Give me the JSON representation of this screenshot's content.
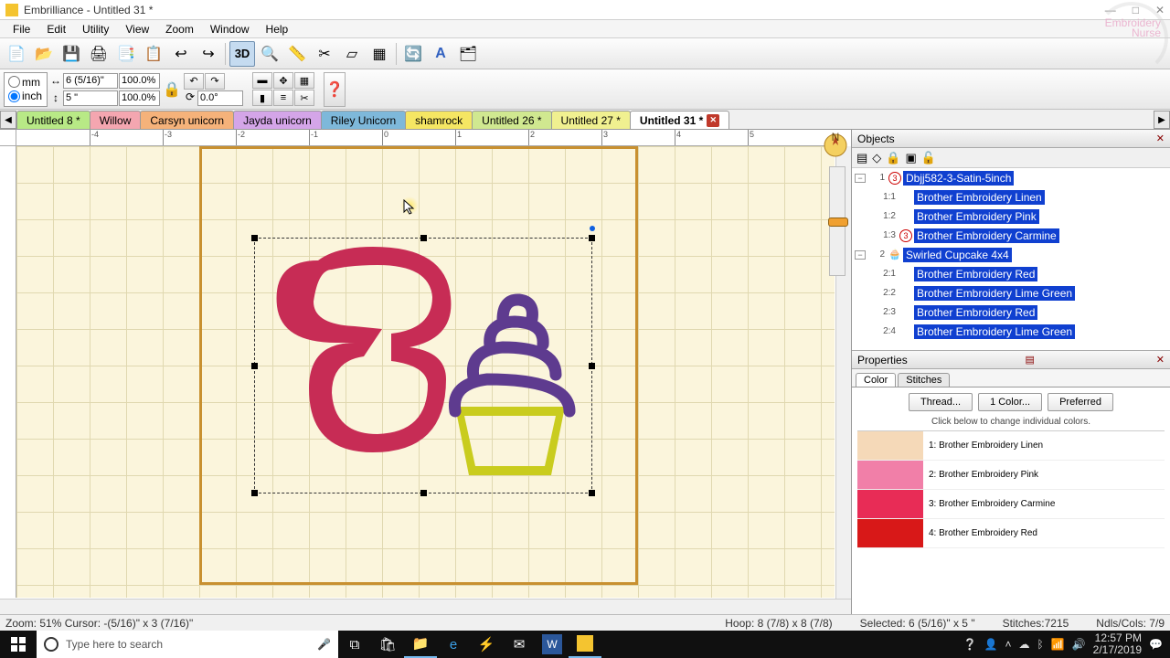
{
  "titlebar": {
    "text": "Embrilliance  -  Untitled 31 *"
  },
  "menu": [
    "File",
    "Edit",
    "Utility",
    "View",
    "Zoom",
    "Window",
    "Help"
  ],
  "units": {
    "mm": "mm",
    "inch": "inch"
  },
  "dims": {
    "w": "6 (5/16)\"",
    "h": "5 \"",
    "wp": "100.0%",
    "hp": "100.0%",
    "rot": "0.0°"
  },
  "tabs": [
    {
      "label": "Untitled 8 *"
    },
    {
      "label": "Willow"
    },
    {
      "label": "Carsyn unicorn"
    },
    {
      "label": "Jayda unicorn"
    },
    {
      "label": "Riley Unicorn"
    },
    {
      "label": "shamrock"
    },
    {
      "label": "Untitled 26 *"
    },
    {
      "label": "Untitled 27 *"
    },
    {
      "label": "Untitled 31 *",
      "active": true
    }
  ],
  "objects_title": "Objects",
  "tree": {
    "n1": {
      "num": "1",
      "label": "Dbjj582-3-Satin-5inch"
    },
    "n11": {
      "num": "1:1",
      "label": "Brother Embroidery Linen"
    },
    "n12": {
      "num": "1:2",
      "label": "Brother Embroidery Pink"
    },
    "n13": {
      "num": "1:3",
      "label": "Brother Embroidery Carmine"
    },
    "n2": {
      "num": "2",
      "label": "Swirled Cupcake 4x4"
    },
    "n21": {
      "num": "2:1",
      "label": "Brother Embroidery Red"
    },
    "n22": {
      "num": "2:2",
      "label": "Brother Embroidery Lime Green"
    },
    "n23": {
      "num": "2:3",
      "label": "Brother Embroidery Red"
    },
    "n24": {
      "num": "2:4",
      "label": "Brother Embroidery Lime Green"
    }
  },
  "properties_title": "Properties",
  "prop_tabs": {
    "color": "Color",
    "stitches": "Stitches"
  },
  "prop_buttons": {
    "thread": "Thread...",
    "one": "1 Color...",
    "pref": "Preferred"
  },
  "prop_hint": "Click below to change individual colors.",
  "colors": [
    {
      "idx": "1",
      "name": "Brother Embroidery Linen",
      "hex": "#f5d9b8"
    },
    {
      "idx": "2",
      "name": "Brother Embroidery Pink",
      "hex": "#f17fa8"
    },
    {
      "idx": "3",
      "name": "Brother Embroidery Carmine",
      "hex": "#e82c56"
    },
    {
      "idx": "4",
      "name": "Brother Embroidery Red",
      "hex": "#d81818"
    }
  ],
  "status": {
    "zoom": "Zoom: 51%  Cursor: -(5/16)\" x 3 (7/16)\"",
    "hoop": "Hoop: 8 (7/8) x 8 (7/8)",
    "sel": "Selected: 6 (5/16)\" x 5 \"",
    "stitches": "Stitches:7215",
    "ndls": "Ndls/Cols: 7/9"
  },
  "taskbar": {
    "search_placeholder": "Type here to search",
    "time": "12:57 PM",
    "date": "2/17/2019"
  },
  "watermark": {
    "l1": "Embroidery",
    "l2": "Nurse"
  }
}
